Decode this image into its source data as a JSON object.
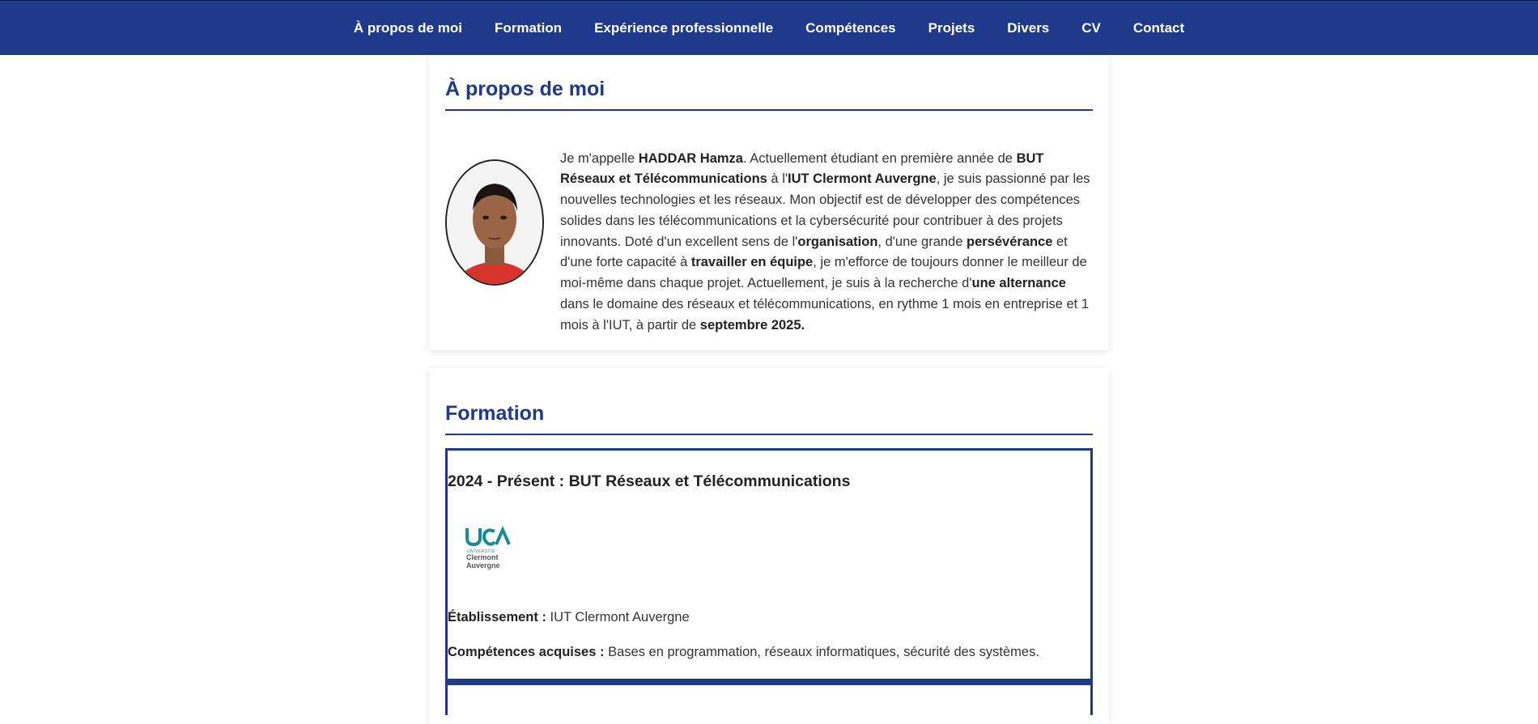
{
  "nav": {
    "items": [
      {
        "label": "À propos de moi"
      },
      {
        "label": "Formation"
      },
      {
        "label": "Expérience professionnelle"
      },
      {
        "label": "Compétences"
      },
      {
        "label": "Projets"
      },
      {
        "label": "Divers"
      },
      {
        "label": "CV"
      },
      {
        "label": "Contact"
      }
    ]
  },
  "about": {
    "title": "À propos de moi",
    "bio": {
      "t1": "Je m'appelle ",
      "b1": "HADDAR Hamza",
      "t2": ". Actuellement étudiant en première année de ",
      "b2": "BUT Réseaux et Télécommunications",
      "t3": " à l'",
      "b3": "IUT Clermont Auvergne",
      "t4": ", je suis passionné par les nouvelles technologies et les réseaux. Mon objectif est de développer des compétences solides dans les télécommunications et la cybersécurité pour contribuer à des projets innovants. Doté d'un excellent sens de l'",
      "b4": "organisation",
      "t5": ", d'une grande ",
      "b5": "persévérance",
      "t6": " et d'une forte capacité à ",
      "b6": "travailler en équipe",
      "t7": ", je m'efforce de toujours donner le meilleur de moi-même dans chaque projet. Actuellement, je suis à la recherche d'",
      "b7": "une alternance",
      "t8": " dans le domaine des réseaux et télécommunications, en rythme 1 mois en entreprise et 1 mois à l'IUT, à partir de ",
      "b8": "septembre 2025."
    }
  },
  "formation": {
    "title": "Formation",
    "entries": [
      {
        "heading": "2024 - Présent : BUT Réseaux et Télécommunications",
        "logo_text": [
          "UNIVERSITÉ",
          "Clermont",
          "Auvergne"
        ],
        "etab_label": "Établissement :",
        "etab_value": " IUT Clermont Auvergne",
        "comp_label": "Compétences acquises :",
        "comp_value": " Bases en programmation, réseaux informatiques, sécurité des systèmes."
      }
    ]
  },
  "colors": {
    "brand": "#1f3a8a",
    "logo_teal": "#1a8a96"
  }
}
